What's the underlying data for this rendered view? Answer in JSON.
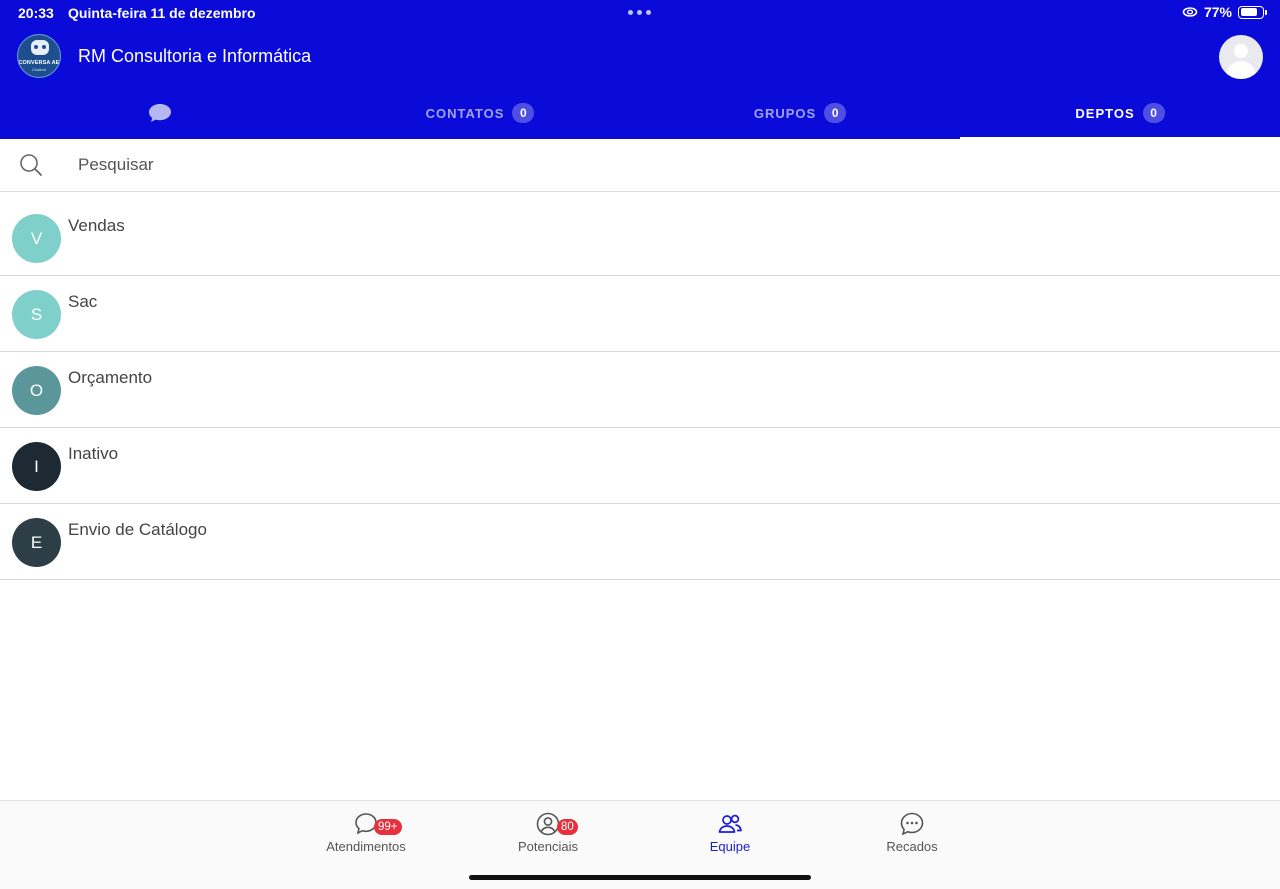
{
  "status_bar": {
    "time": "20:33",
    "date": "Quinta-feira 11 de dezembro",
    "battery": "77%",
    "battery_level": 0.77
  },
  "header": {
    "logo_text": "CONVERSA AE",
    "logo_subtext": "Chatbot",
    "title": "RM Consultoria e Informática"
  },
  "tabs": [
    {
      "icon": "chat-bubble-icon",
      "label": "",
      "count": ""
    },
    {
      "label": "CONTATOS",
      "count": "0"
    },
    {
      "label": "GRUPOS",
      "count": "0"
    },
    {
      "label": "DEPTOS",
      "count": "0"
    }
  ],
  "active_tab": "DEPTOS",
  "search": {
    "placeholder": "Pesquisar"
  },
  "departments": [
    {
      "initial": "V",
      "name": "Vendas",
      "color": "#7fcfcb"
    },
    {
      "initial": "S",
      "name": "Sac",
      "color": "#7fcfcb"
    },
    {
      "initial": "O",
      "name": "Orçamento",
      "color": "#5b969b"
    },
    {
      "initial": "I",
      "name": "Inativo",
      "color": "#1e2a33"
    },
    {
      "initial": "E",
      "name": "Envio de Catálogo",
      "color": "#2e3e47"
    }
  ],
  "bottom_nav": [
    {
      "label": "Atendimentos",
      "badge": "99+",
      "icon": "chat-icon"
    },
    {
      "label": "Potenciais",
      "badge": "80",
      "icon": "user-circle-icon"
    },
    {
      "label": "Equipe",
      "badge": "",
      "icon": "team-icon"
    },
    {
      "label": "Recados",
      "badge": "",
      "icon": "message-dots-icon"
    }
  ],
  "colors": {
    "header_bg": "#0a0ad9",
    "accent": "#1a1adb",
    "badge": "#e6303e"
  }
}
